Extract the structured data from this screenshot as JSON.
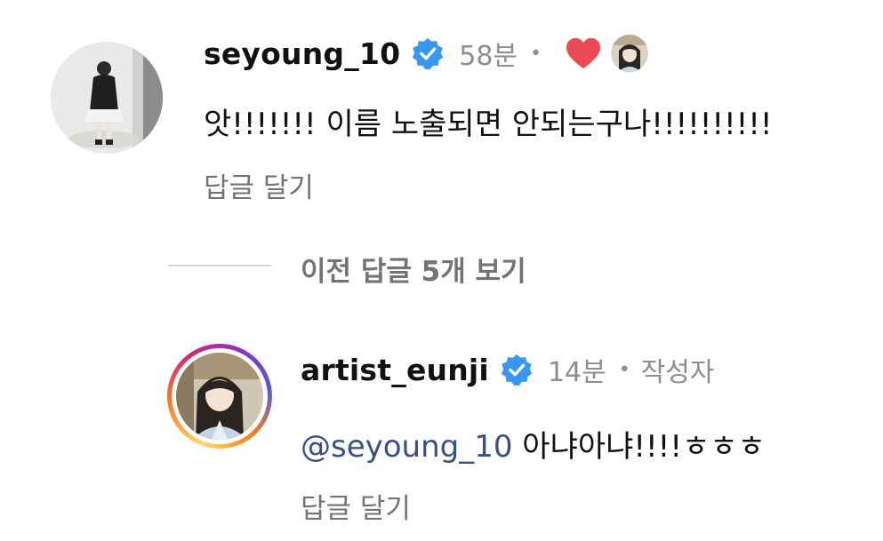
{
  "comments": [
    {
      "username": "seyoung_10",
      "time": "58분",
      "text": "앗!!!!!!! 이름 노출되면 안되는구나!!!!!!!!!!",
      "reply_action": "답글 달기",
      "liked_by_author": true,
      "avatar_icon": "avatar-photo-standing-person",
      "verified": true
    }
  ],
  "replies_toggle": {
    "label": "이전 답글 5개 보기"
  },
  "reply": {
    "username": "artist_eunji",
    "time": "14분",
    "author_badge": "작성자",
    "mention": "@seyoung_10",
    "text": " 아냐아냐!!!!ㅎㅎㅎ",
    "reply_action": "답글 달기",
    "has_story_ring": true,
    "verified": true
  },
  "colors": {
    "verified_blue": "#3897f0",
    "heart_red": "#ed4956",
    "mention_blue": "#385185",
    "muted_gray": "#737373"
  }
}
